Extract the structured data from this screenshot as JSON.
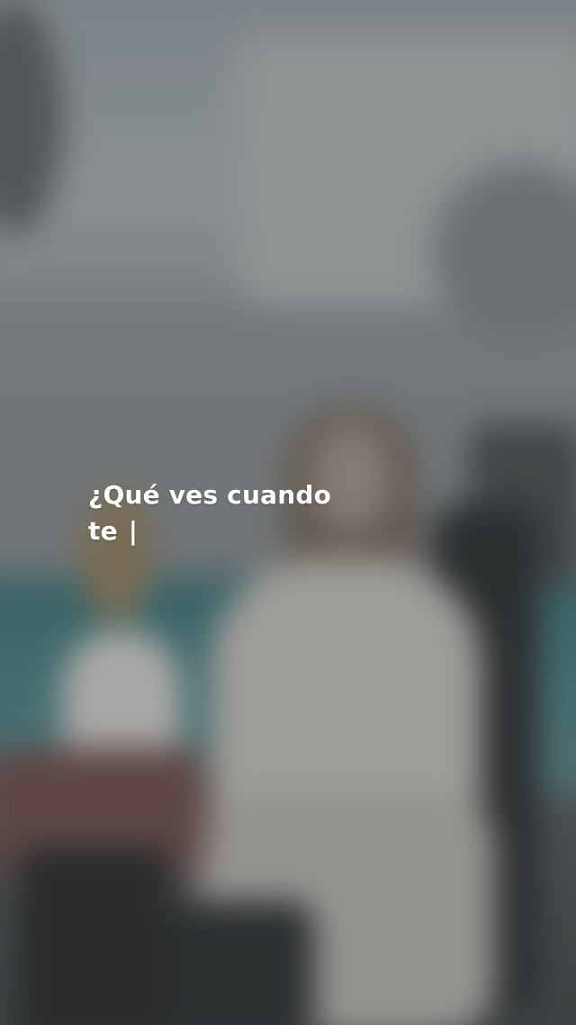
{
  "caption": {
    "line1": "¿Qué ves cuando",
    "line2": "te",
    "cursor": "|"
  },
  "colors": {
    "caption_text": "#ffffff",
    "pool": "#4d7d80",
    "background": "#707478"
  }
}
